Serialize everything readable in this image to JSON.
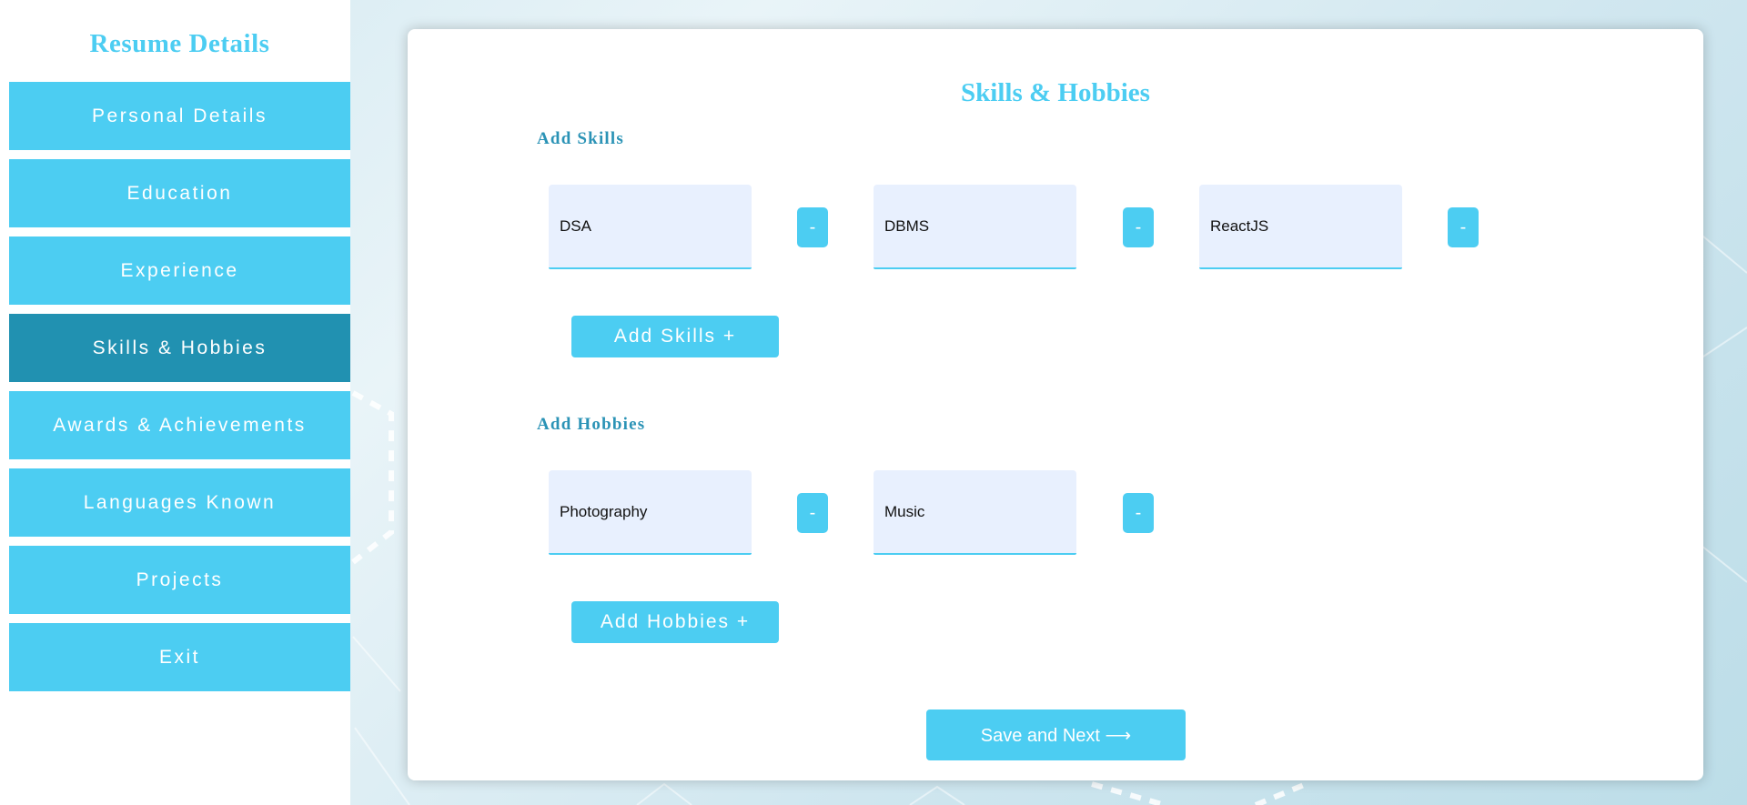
{
  "sidebar": {
    "title": "Resume Details",
    "items": [
      {
        "label": "Personal Details",
        "active": false
      },
      {
        "label": "Education",
        "active": false
      },
      {
        "label": "Experience",
        "active": false
      },
      {
        "label": "Skills & Hobbies",
        "active": true
      },
      {
        "label": "Awards & Achievements",
        "active": false
      },
      {
        "label": "Languages Known",
        "active": false
      },
      {
        "label": "Projects",
        "active": false
      },
      {
        "label": "Exit",
        "active": false
      }
    ]
  },
  "main": {
    "title": "Skills & Hobbies",
    "skills": {
      "label": "Add Skills",
      "values": [
        "DSA",
        "DBMS",
        "ReactJS"
      ],
      "remove_label": "-",
      "add_button": "Add Skills +"
    },
    "hobbies": {
      "label": "Add Hobbies",
      "values": [
        "Photography",
        "Music"
      ],
      "remove_label": "-",
      "add_button": "Add Hobbies +"
    },
    "save_button": "Save and Next ⟶"
  },
  "colors": {
    "accent": "#4ccdf2",
    "active_nav": "#2191b1",
    "section_label": "#2b93b6",
    "field_bg": "#e8f0fe"
  }
}
